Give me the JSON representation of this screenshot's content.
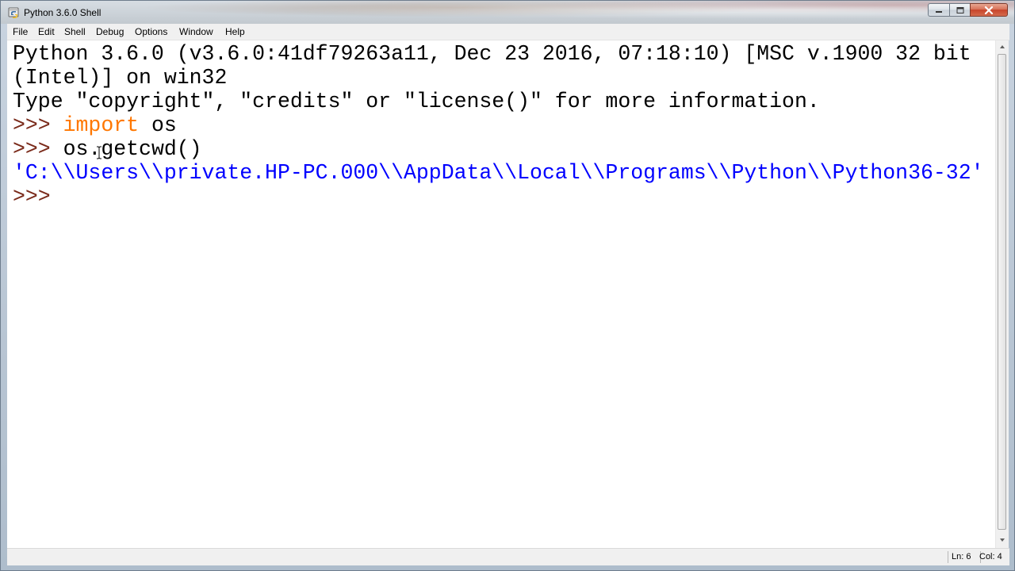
{
  "window": {
    "title": "Python 3.6.0 Shell",
    "icon": "python-idle-icon"
  },
  "menu": [
    "File",
    "Edit",
    "Shell",
    "Debug",
    "Options",
    "Window",
    "Help"
  ],
  "shell": {
    "banner_line1": "Python 3.6.0 (v3.6.0:41df79263a11, Dec 23 2016, 07:18:10) [MSC v.1900 32 bit",
    "banner_line2": "(Intel)] on win32",
    "banner_line3": "Type \"copyright\", \"credits\" or \"license()\" for more information.",
    "prompt": ">>>",
    "cmd1_keyword": "import",
    "cmd1_rest": " os",
    "cmd2": "os.getcwd()",
    "output": "'C:\\\\Users\\\\private.HP-PC.000\\\\AppData\\\\Local\\\\Programs\\\\Python\\\\Python36-32'"
  },
  "status": {
    "line": "Ln: 6",
    "col": "Col: 4"
  },
  "colors": {
    "prompt": "#7a2a1a",
    "keyword": "#ff7700",
    "output": "#0000ff"
  }
}
